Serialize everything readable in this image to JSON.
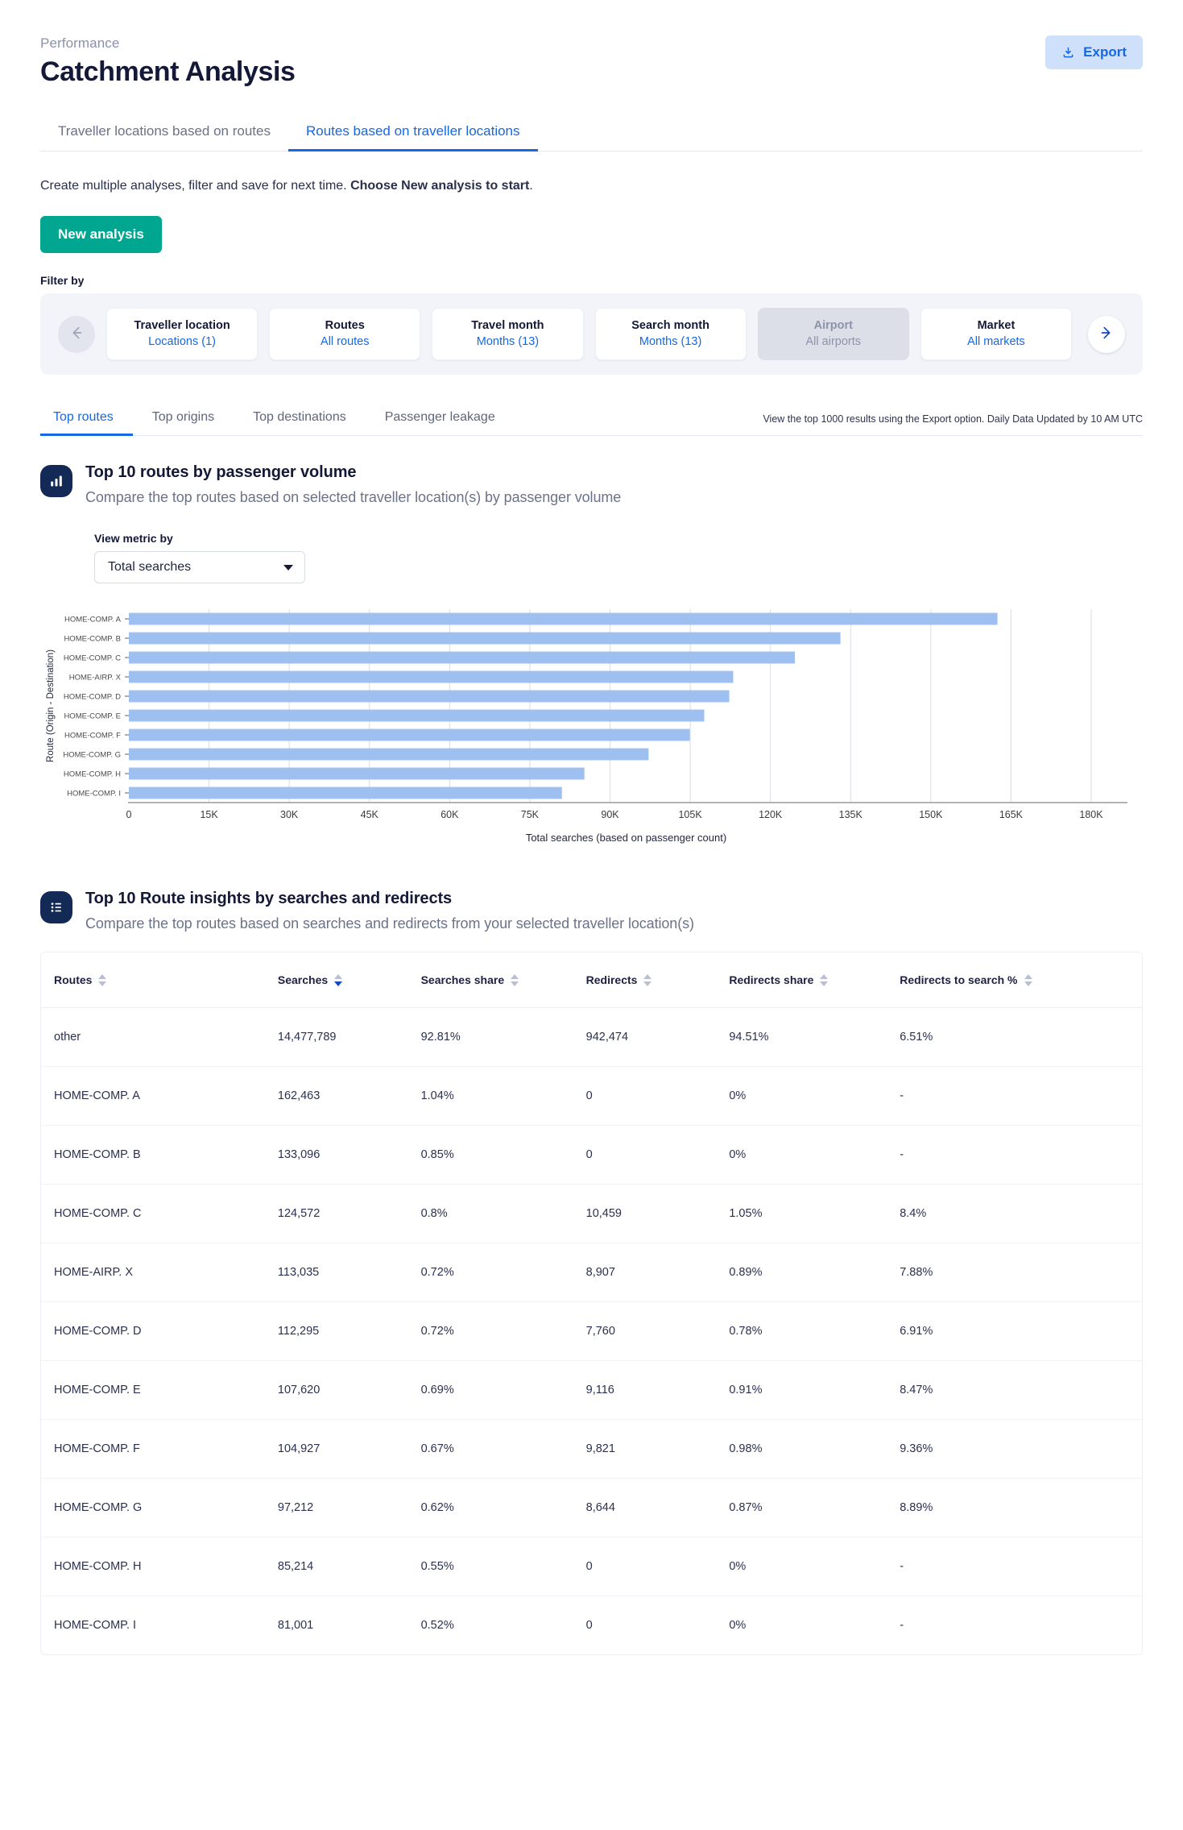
{
  "header": {
    "breadcrumb": "Performance",
    "title": "Catchment Analysis",
    "export_label": "Export"
  },
  "tabs": [
    {
      "label": "Traveller locations based on routes",
      "active": false
    },
    {
      "label": "Routes based on traveller locations",
      "active": true
    }
  ],
  "intro": {
    "text_plain": "Create multiple analyses, filter and save for next time. ",
    "text_bold": "Choose New analysis to start",
    "text_end": ".",
    "new_analysis_label": "New analysis"
  },
  "filter": {
    "label": "Filter by",
    "prev_icon": "arrow-left-icon",
    "next_icon": "arrow-right-icon",
    "chips": [
      {
        "title": "Traveller location",
        "value": "Locations (1)",
        "disabled": false
      },
      {
        "title": "Routes",
        "value": "All routes",
        "disabled": false
      },
      {
        "title": "Travel month",
        "value": "Months (13)",
        "disabled": false
      },
      {
        "title": "Search month",
        "value": "Months (13)",
        "disabled": false
      },
      {
        "title": "Airport",
        "value": "All airports",
        "disabled": true
      },
      {
        "title": "Market",
        "value": "All markets",
        "disabled": false
      }
    ]
  },
  "subtabs": {
    "items": [
      {
        "label": "Top routes",
        "active": true
      },
      {
        "label": "Top origins",
        "active": false
      },
      {
        "label": "Top destinations",
        "active": false
      },
      {
        "label": "Passenger leakage",
        "active": false
      }
    ],
    "note": "View the top 1000 results using the Export option. Daily Data Updated by 10 AM UTC"
  },
  "chart_section": {
    "icon": "bar-chart-icon",
    "title": "Top 10 routes by passenger volume",
    "subtitle": "Compare the top routes based on selected traveller location(s) by passenger volume",
    "metric_label": "View metric by",
    "metric_value": "Total searches"
  },
  "table_section": {
    "icon": "list-icon",
    "title": "Top 10 Route insights by searches and redirects",
    "subtitle": "Compare the top routes based on searches and redirects from your selected traveller location(s)"
  },
  "chart_data": {
    "type": "bar",
    "orientation": "horizontal",
    "title": "",
    "xlabel": "Total searches (based on passenger count)",
    "ylabel": "Route (Origin - Destination)",
    "xlim": [
      0,
      180000
    ],
    "xticks": [
      0,
      15000,
      30000,
      45000,
      60000,
      75000,
      90000,
      105000,
      120000,
      135000,
      150000,
      165000,
      180000
    ],
    "xticklabels": [
      "0",
      "15K",
      "30K",
      "45K",
      "60K",
      "75K",
      "90K",
      "105K",
      "120K",
      "135K",
      "150K",
      "165K",
      "180K"
    ],
    "grid": true,
    "bar_color": "#9dc0f0",
    "categories": [
      "HOME-COMP. A",
      "HOME-COMP. B",
      "HOME-COMP. C",
      "HOME-AIRP. X",
      "HOME-COMP. D",
      "HOME-COMP. E",
      "HOME-COMP. F",
      "HOME-COMP. G",
      "HOME-COMP. H",
      "HOME-COMP. I"
    ],
    "values": [
      162463,
      133096,
      124572,
      113035,
      112295,
      107620,
      104927,
      97212,
      85214,
      81001
    ]
  },
  "table": {
    "columns": [
      {
        "label": "Routes",
        "sorted": false
      },
      {
        "label": "Searches",
        "sorted": true
      },
      {
        "label": "Searches share",
        "sorted": false
      },
      {
        "label": "Redirects",
        "sorted": false
      },
      {
        "label": "Redirects share",
        "sorted": false
      },
      {
        "label": "Redirects to search %",
        "sorted": false
      }
    ],
    "rows": [
      {
        "route": "other",
        "searches": "14,477,789",
        "searches_share": "92.81%",
        "redirects": "942,474",
        "redirects_share": "94.51%",
        "redirects_to_search": "6.51%"
      },
      {
        "route": "HOME-COMP. A",
        "searches": "162,463",
        "searches_share": "1.04%",
        "redirects": "0",
        "redirects_share": "0%",
        "redirects_to_search": "-"
      },
      {
        "route": "HOME-COMP. B",
        "searches": "133,096",
        "searches_share": "0.85%",
        "redirects": "0",
        "redirects_share": "0%",
        "redirects_to_search": "-"
      },
      {
        "route": "HOME-COMP. C",
        "searches": "124,572",
        "searches_share": "0.8%",
        "redirects": "10,459",
        "redirects_share": "1.05%",
        "redirects_to_search": "8.4%"
      },
      {
        "route": "HOME-AIRP. X",
        "searches": "113,035",
        "searches_share": "0.72%",
        "redirects": "8,907",
        "redirects_share": "0.89%",
        "redirects_to_search": "7.88%"
      },
      {
        "route": "HOME-COMP. D",
        "searches": "112,295",
        "searches_share": "0.72%",
        "redirects": "7,760",
        "redirects_share": "0.78%",
        "redirects_to_search": "6.91%"
      },
      {
        "route": "HOME-COMP. E",
        "searches": "107,620",
        "searches_share": "0.69%",
        "redirects": "9,116",
        "redirects_share": "0.91%",
        "redirects_to_search": "8.47%"
      },
      {
        "route": "HOME-COMP. F",
        "searches": "104,927",
        "searches_share": "0.67%",
        "redirects": "9,821",
        "redirects_share": "0.98%",
        "redirects_to_search": "9.36%"
      },
      {
        "route": "HOME-COMP. G",
        "searches": "97,212",
        "searches_share": "0.62%",
        "redirects": "8,644",
        "redirects_share": "0.87%",
        "redirects_to_search": "8.89%"
      },
      {
        "route": "HOME-COMP. H",
        "searches": "85,214",
        "searches_share": "0.55%",
        "redirects": "0",
        "redirects_share": "0%",
        "redirects_to_search": "-"
      },
      {
        "route": "HOME-COMP. I",
        "searches": "81,001",
        "searches_share": "0.52%",
        "redirects": "0",
        "redirects_share": "0%",
        "redirects_to_search": "-"
      }
    ]
  },
  "colors": {
    "accent_blue": "#1668e3",
    "brand_navy": "#141938",
    "green": "#00a690",
    "bar_blue": "#9dc0f0",
    "export_bg": "#cfe0fb"
  }
}
